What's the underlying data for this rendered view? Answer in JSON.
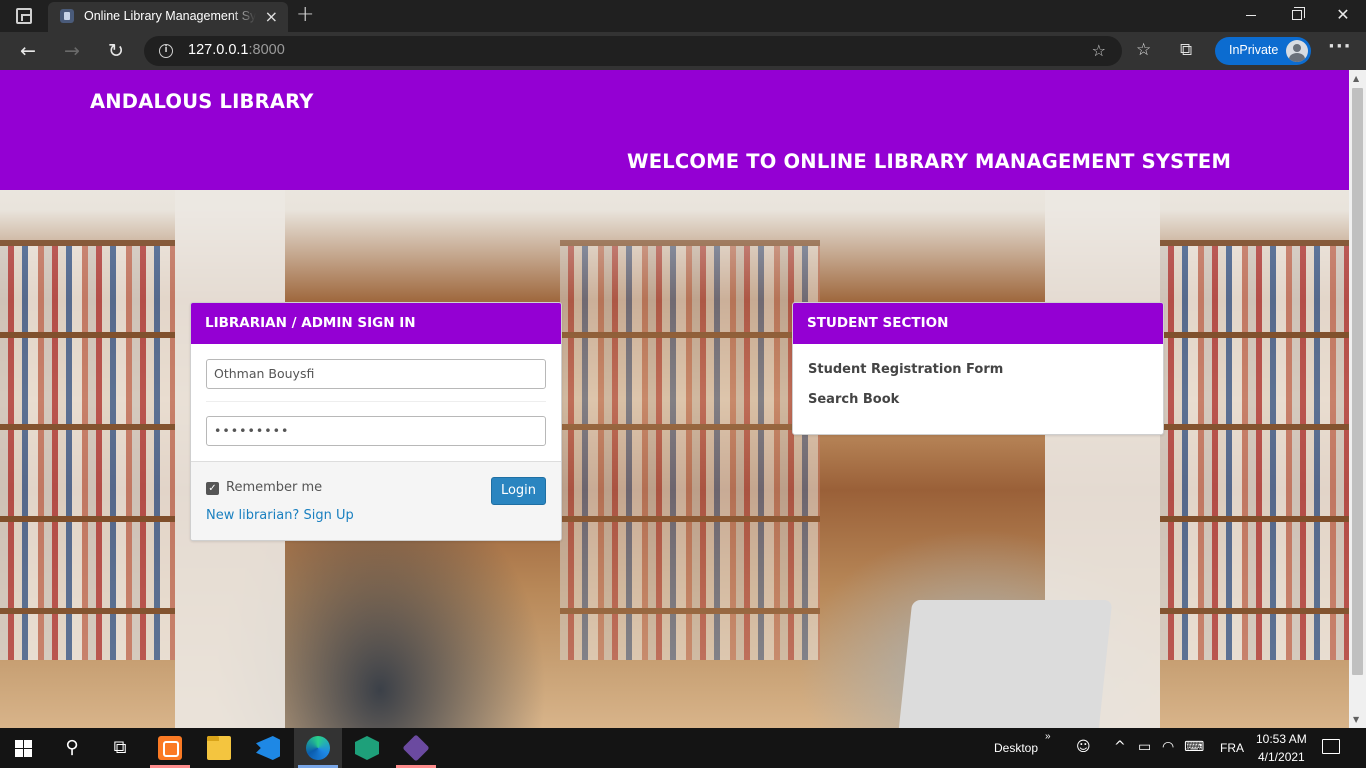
{
  "browser": {
    "tab_title": "Online Library Management System",
    "tab_close": "×",
    "new_tab": "+",
    "url_host": "127.0.0.1",
    "url_port": ":8000",
    "inprivate_label": "InPrivate",
    "back": "←",
    "forward": "→",
    "reload": "↻",
    "more": "···",
    "window_close": "✕"
  },
  "page": {
    "site_title": "ANDALOUS LIBRARY",
    "welcome": "WELCOME TO ONLINE LIBRARY MANAGEMENT SYSTEM",
    "login_panel": {
      "heading": "LIBRARIAN / ADMIN SIGN IN",
      "username_value": "Othman Bouysfi",
      "password_value": "•••••••••",
      "remember_label": "Remember me",
      "remember_checked": true,
      "login_button": "Login",
      "signup_link": "New librarian? Sign Up"
    },
    "student_panel": {
      "heading": "STUDENT SECTION",
      "links": [
        "Student Registration Form",
        "Search Book"
      ]
    }
  },
  "taskbar": {
    "apps": [
      "xampp",
      "file-explorer",
      "vscode",
      "edge",
      "kaspersky",
      "git"
    ],
    "desktop_label": "Desktop",
    "overflow_chevron": "»",
    "language": "FRA",
    "time": "10:53 AM",
    "date": "4/1/2021"
  },
  "colors": {
    "brand_purple": "#9400d3",
    "login_button_blue": "#2a85c0",
    "link_blue": "#1a80c0",
    "inprivate_blue": "#0c6cd0"
  },
  "icons": {
    "tab_favicon": "library-icon",
    "address_info": "info-icon",
    "address_favorite": "add-favorite-icon",
    "toolbar_favorites": "favorites-icon",
    "toolbar_collections": "collections-icon"
  }
}
